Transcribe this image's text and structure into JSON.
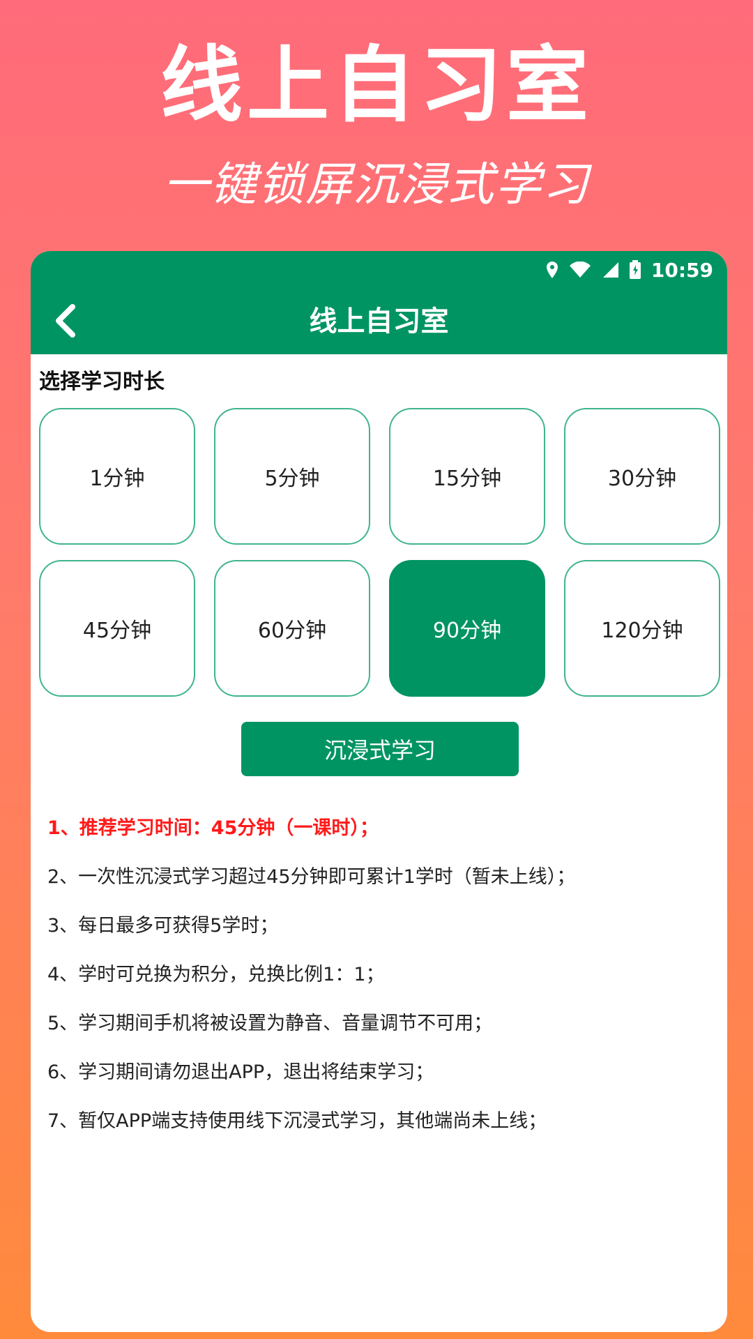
{
  "promo": {
    "title": "线上自习室",
    "subtitle": "一键锁屏沉浸式学习"
  },
  "status_bar": {
    "time": "10:59",
    "icons": [
      "location-icon",
      "wifi-icon",
      "signal-icon",
      "battery-icon"
    ]
  },
  "app_bar": {
    "back_icon": "chevron-left-icon",
    "title": "线上自习室"
  },
  "duration": {
    "label": "选择学习时长",
    "options": [
      "1分钟",
      "5分钟",
      "15分钟",
      "30分钟",
      "45分钟",
      "60分钟",
      "90分钟",
      "120分钟"
    ],
    "selected": "90分钟"
  },
  "start_button": {
    "label": "沉浸式学习"
  },
  "rules": [
    "1、推荐学习时间：45分钟（一课时）；",
    "2、一次性沉浸式学习超过45分钟即可累计1学时（暂未上线）；",
    "3、每日最多可获得5学时；",
    "4、学时可兑换为积分，兑换比例1：1；",
    "5、学习期间手机将被设置为静音、音量调节不可用；",
    "6、学习期间请勿退出APP，退出将结束学习；",
    "7、暂仅APP端支持使用线下沉浸式学习，其他端尚未上线；"
  ],
  "colors": {
    "primary_green": "#009462",
    "border_green": "#3fb58a",
    "highlight_red": "#ff1a1a",
    "background_top": "#ff6b7a",
    "background_bottom": "#ff8a3c"
  }
}
